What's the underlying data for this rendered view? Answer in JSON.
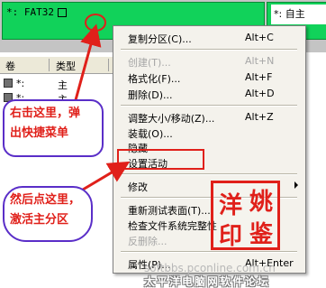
{
  "partition_map": {
    "fat_label": "*: FAT32",
    "other_label": "*: 自主"
  },
  "table": {
    "columns": [
      "卷",
      "类型"
    ],
    "rows": [
      {
        "name": "*:",
        "type": "主"
      },
      {
        "name": "*:",
        "type": "主"
      }
    ]
  },
  "context_menu": {
    "items": [
      {
        "label": "复制分区(C)...",
        "shortcut": "Alt+C",
        "disabled": false
      },
      {
        "label": "创建(T)...",
        "shortcut": "Alt+N",
        "disabled": true
      },
      {
        "label": "格式化(F)...",
        "shortcut": "Alt+F",
        "disabled": false
      },
      {
        "label": "删除(D)...",
        "shortcut": "Alt+D",
        "disabled": false
      },
      {
        "label": "调整大小/移动(Z)...",
        "shortcut": "Alt+Z",
        "disabled": false
      },
      {
        "label": "装载(O)...",
        "shortcut": "",
        "disabled": false
      },
      {
        "label": "隐藏",
        "shortcut": "",
        "disabled": false
      },
      {
        "label": "设置活动",
        "shortcut": "",
        "disabled": false
      },
      {
        "label": "修改",
        "shortcut": "",
        "disabled": false
      },
      {
        "label": "重新测试表面(T)...",
        "shortcut": "",
        "disabled": false
      },
      {
        "label": "检查文件系统完整性",
        "shortcut": "",
        "disabled": false
      },
      {
        "label": "反删除...",
        "shortcut": "",
        "disabled": true
      },
      {
        "label": "属性(P)...",
        "shortcut": "Alt+Enter",
        "disabled": false
      }
    ]
  },
  "annotations": {
    "callout1_line1": "右击这里，弹",
    "callout1_line2": "出快捷菜单",
    "callout2_line1": "然后点这里，",
    "callout2_line2": "激活主分区",
    "stamp_chars": [
      "洋",
      "姚",
      "印",
      "鉴"
    ]
  },
  "watermark": {
    "url": "softbbs.pconline.com.cn",
    "site": "太平洋电脑网软件论坛"
  },
  "colors": {
    "partition_green": "#11d25a",
    "annotation_red": "#e0201a",
    "callout_border": "#5a2ec8",
    "menu_bg": "#f4f2ec"
  }
}
